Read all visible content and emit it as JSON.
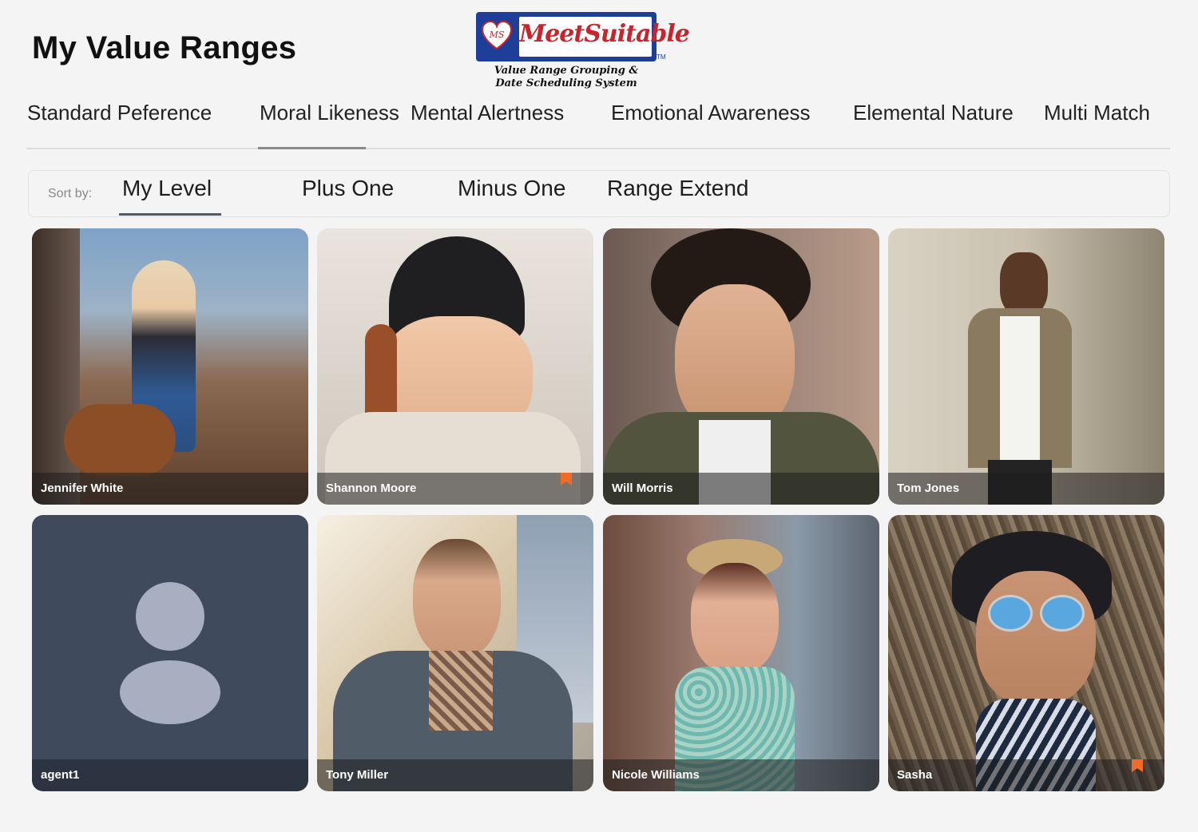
{
  "header": {
    "title": "My Value Ranges",
    "logo": {
      "badge": "MS",
      "brand": "MeetSuitable",
      "tm": "TM",
      "tagline_line1": "Value Range Grouping &",
      "tagline_line2": "Date Scheduling System"
    }
  },
  "tabs": [
    {
      "label": "Standard Peference",
      "active": false
    },
    {
      "label": "Moral Likeness",
      "active": true
    },
    {
      "label": "Mental Alertness",
      "active": false
    },
    {
      "label": "Emotional Awareness",
      "active": false
    },
    {
      "label": "Elemental Nature",
      "active": false
    },
    {
      "label": "Multi Match",
      "active": false
    }
  ],
  "sort": {
    "label": "Sort by:",
    "options": [
      {
        "label": "My Level",
        "active": true
      },
      {
        "label": "Plus One",
        "active": false
      },
      {
        "label": "Minus One",
        "active": false
      },
      {
        "label": "Range Extend",
        "active": false
      }
    ]
  },
  "profiles": [
    {
      "name": "Jennifer White",
      "bookmarked": false
    },
    {
      "name": "Shannon Moore",
      "bookmarked": true
    },
    {
      "name": "Will Morris",
      "bookmarked": false
    },
    {
      "name": "Tom Jones",
      "bookmarked": false
    },
    {
      "name": "agent1",
      "bookmarked": false,
      "placeholder_avatar": true
    },
    {
      "name": "Tony Miller",
      "bookmarked": false
    },
    {
      "name": "Nicole Williams",
      "bookmarked": false
    },
    {
      "name": "Sasha",
      "bookmarked": true
    }
  ],
  "colors": {
    "accent_bookmark": "#f06a28",
    "logo_blue": "#1d3f9a",
    "logo_red": "#c8242b",
    "placeholder_bg": "#3f4b5c",
    "placeholder_avatar": "#a7afc1"
  }
}
